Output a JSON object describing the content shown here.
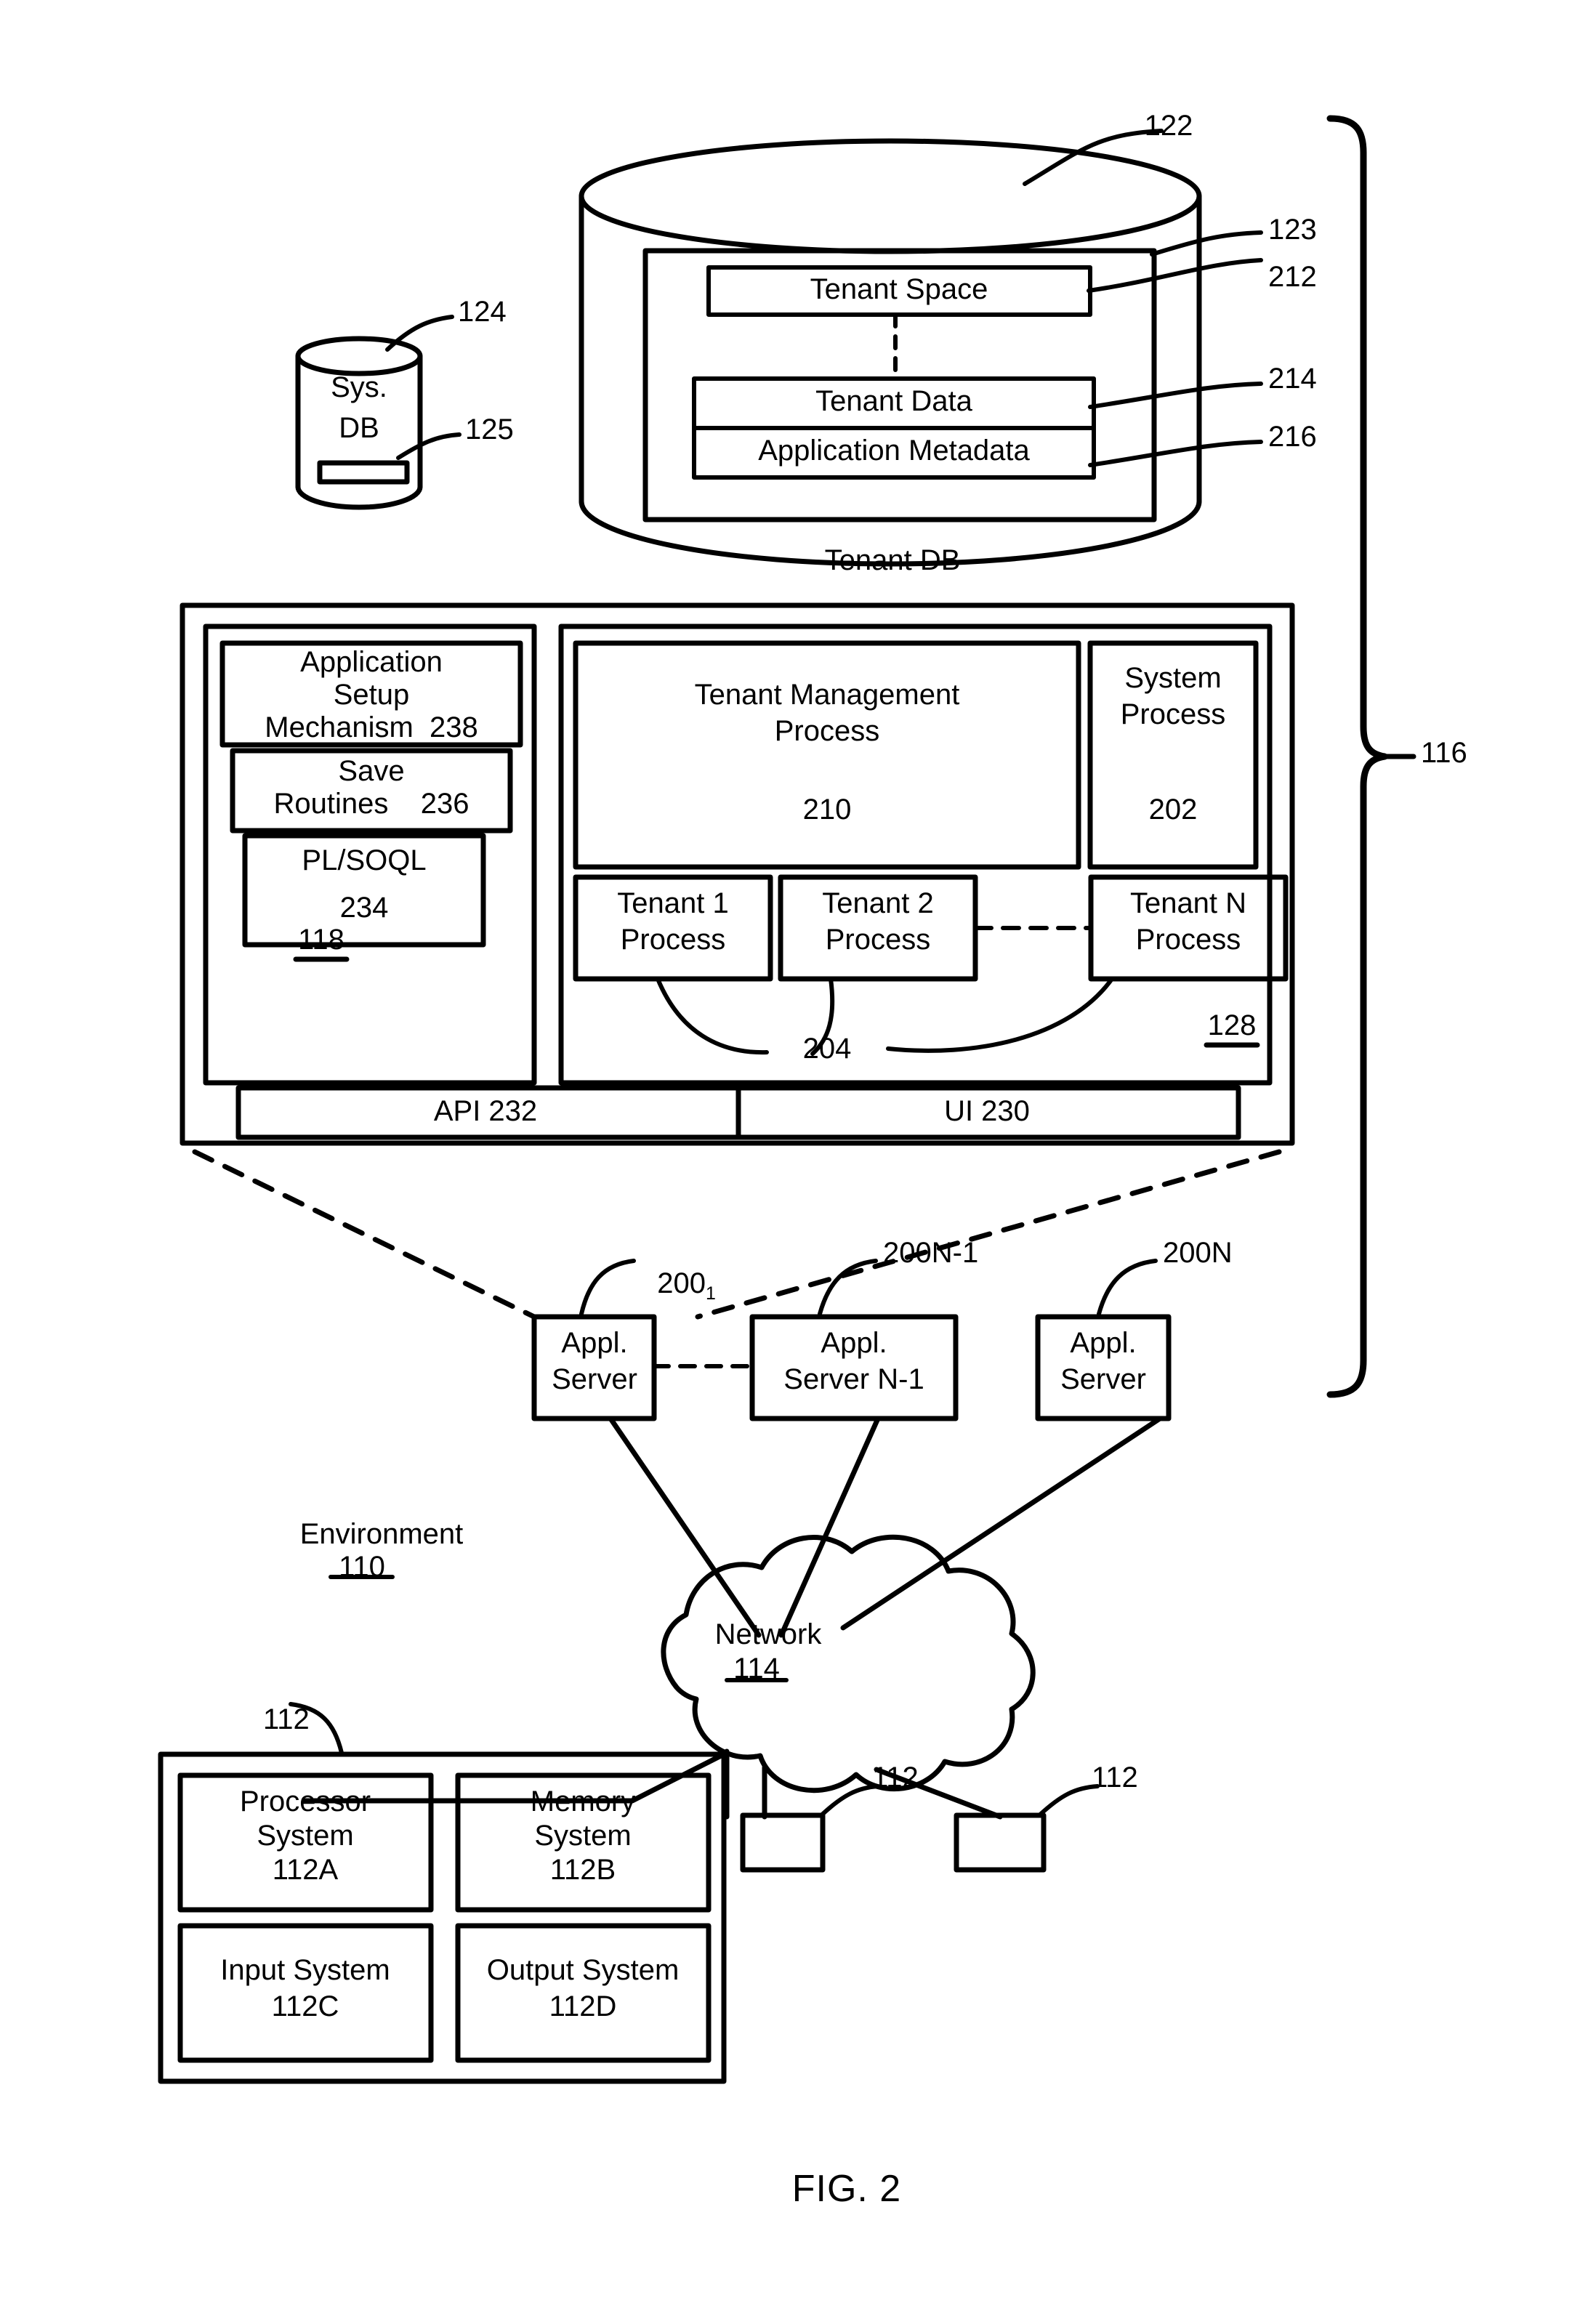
{
  "figure": {
    "caption": "FIG. 2",
    "bracket_label": "116"
  },
  "tenant_db": {
    "cylinder_label": "Tenant DB",
    "ref_top": "122",
    "ref_outer": "123",
    "ref_tenant_space": "212",
    "ref_tenant_data": "214",
    "ref_app_metadata": "216",
    "boxes": [
      {
        "label": "Tenant Space"
      },
      {
        "label": "Tenant Data"
      },
      {
        "label": "Application Metadata"
      }
    ]
  },
  "sys_db": {
    "line1": "Sys.",
    "line2": "DB",
    "ref_db": "124",
    "ref_slot": "125"
  },
  "server_block": {
    "left_panel": {
      "ref": "118",
      "boxes": [
        {
          "lines": [
            "Application",
            "Setup",
            "Mechanism  238"
          ]
        },
        {
          "lines": [
            "Save",
            "Routines    236"
          ]
        },
        {
          "lines": [
            "PL/SOQL",
            "234"
          ]
        }
      ]
    },
    "right_panel": {
      "ref": "128",
      "tenant_management": {
        "lines": [
          "Tenant Management",
          "Process"
        ],
        "ref": "210"
      },
      "system_process": {
        "lines": [
          "System",
          "Process"
        ],
        "ref": "202"
      },
      "tenant_processes": [
        {
          "lines": [
            "Tenant 1",
            "Process"
          ]
        },
        {
          "lines": [
            "Tenant 2",
            "Process"
          ]
        },
        {
          "lines": [
            "Tenant N",
            "Process"
          ]
        }
      ],
      "tenant_process_ref": "204"
    },
    "bottom_bar": [
      {
        "label": "API 232"
      },
      {
        "label": "UI 230"
      }
    ]
  },
  "app_servers": [
    {
      "lines": [
        "Appl.",
        "Server"
      ],
      "ref": "200",
      "ref_sub": "1"
    },
    {
      "lines": [
        "Appl.",
        "Server N-1"
      ],
      "ref": "200N-1",
      "ref_sub": ""
    },
    {
      "lines": [
        "Appl.",
        "Server"
      ],
      "ref": "200N",
      "ref_sub": ""
    }
  ],
  "environment": {
    "label": "Environment",
    "ref": "110"
  },
  "network": {
    "label": "Network",
    "ref": "114"
  },
  "user_system": {
    "ref": "112",
    "boxes": [
      {
        "lines": [
          "Processor",
          "System",
          "112A"
        ]
      },
      {
        "lines": [
          "Memory",
          "System",
          "112B"
        ]
      },
      {
        "lines": [
          "Input System",
          "112C"
        ]
      },
      {
        "lines": [
          "Output System",
          "112D"
        ]
      }
    ]
  },
  "clients": [
    {
      "ref": "112"
    },
    {
      "ref": "112"
    }
  ]
}
